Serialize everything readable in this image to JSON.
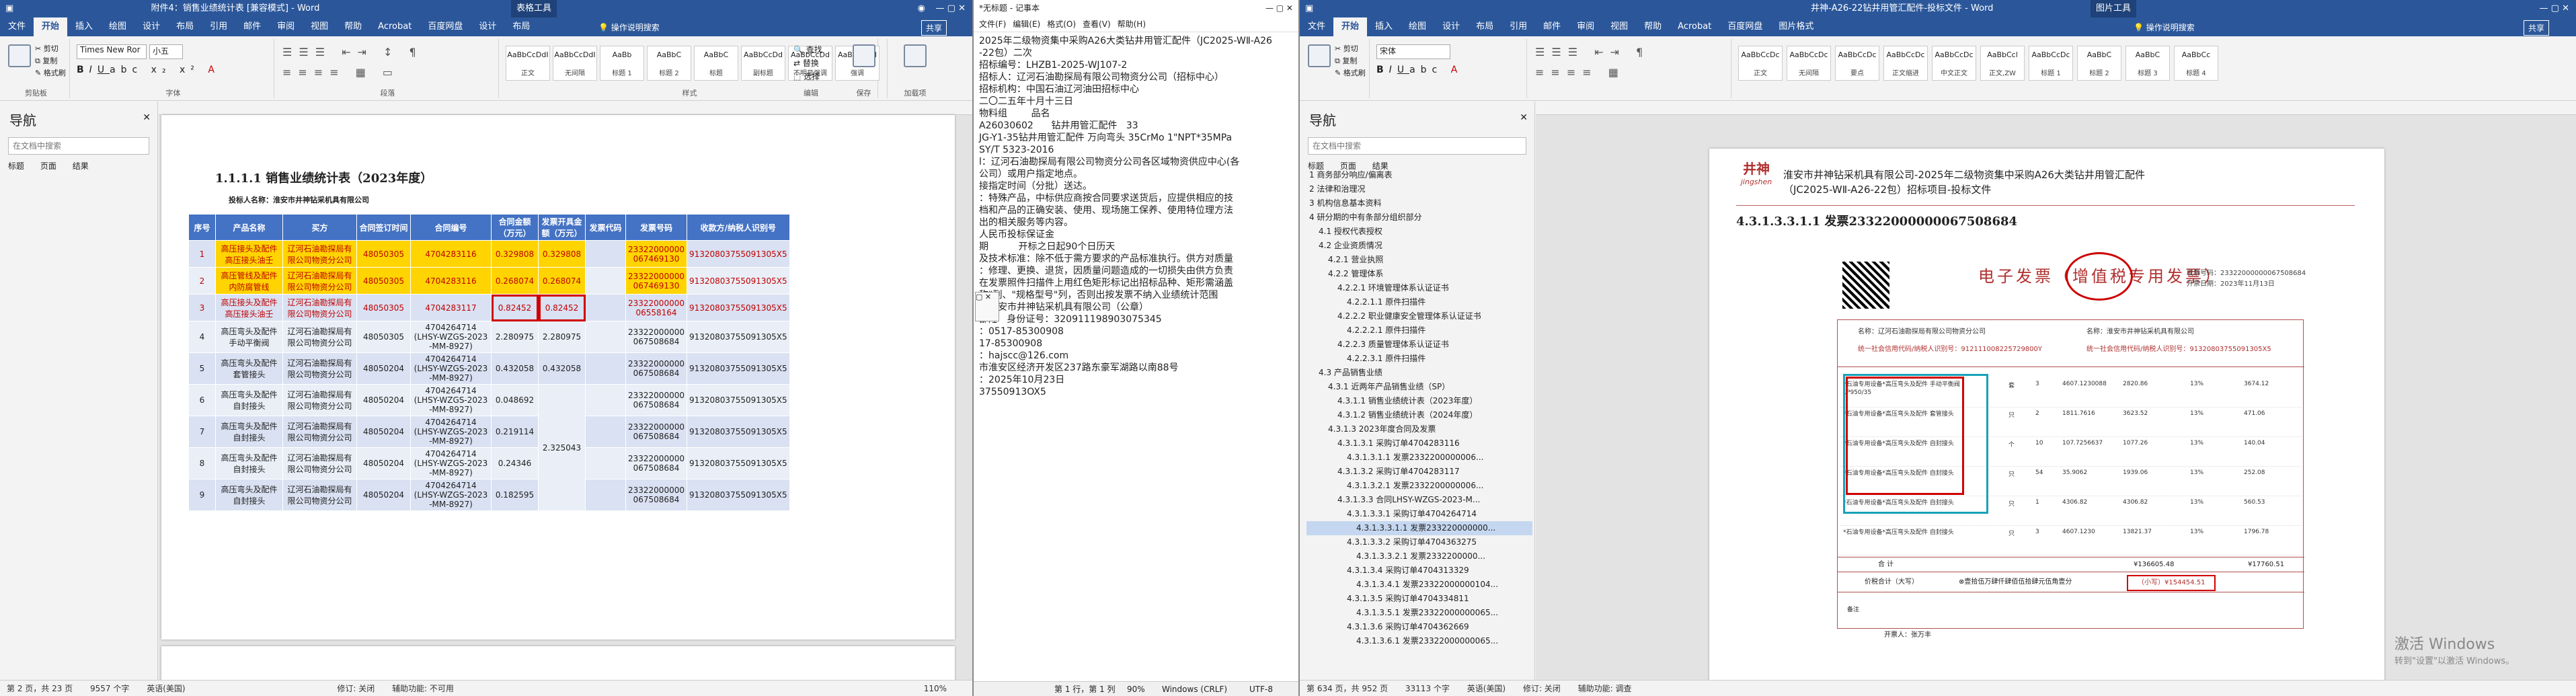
{
  "word1": {
    "title": "附件4：销售业绩统计表 [兼容模式] - Word",
    "context_tab": "表格工具",
    "tabs": [
      "文件",
      "开始",
      "插入",
      "绘图",
      "设计",
      "布局",
      "引用",
      "邮件",
      "审阅",
      "视图",
      "帮助",
      "Acrobat",
      "百度网盘",
      "设计",
      "布局"
    ],
    "search_hint": "操作说明搜索",
    "share": "共享",
    "font_name": "Times New Ror",
    "font_size": "小五",
    "styles": [
      [
        "AaBbCcDdI",
        "正文"
      ],
      [
        "AaBbCcDdI",
        "无间隔"
      ],
      [
        "AaBb",
        "标题 1"
      ],
      [
        "AaBbC",
        "标题 2"
      ],
      [
        "AaBbC",
        "标题"
      ],
      [
        "AaBbCcDd",
        "副标题"
      ],
      [
        "AaBbCcDd",
        "不明显强调"
      ],
      [
        "AaBbCcDd",
        "强调"
      ]
    ],
    "groups": [
      "剪贴板",
      "字体",
      "段落",
      "样式",
      "编辑",
      "保存",
      "加载项"
    ],
    "edit_btns": [
      "查找",
      "替换",
      "选择"
    ],
    "nav_title": "导航",
    "nav_search": "在文档中搜索",
    "nav_tabs": [
      "标题",
      "页面",
      "结果"
    ],
    "heading": "1.1.1.1 销售业绩统计表（2023年度）",
    "vendor": "投标人名称：淮安市井神钻采机具有限公司",
    "columns": [
      "序号",
      "产品名称",
      "买方",
      "合同签订时间",
      "合同编号",
      "合同金额（万元）",
      "发票开具金额（万元）",
      "发票代码",
      "发票号码",
      "收款方/纳税人识别号"
    ],
    "rows": [
      [
        "1",
        "高压接头及配件 高压接头油壬",
        "辽河石油勘探局有限公司物资分公司",
        "48050305",
        "4704283116",
        "0.329808",
        "0.329808",
        "",
        "23322000000 067469130",
        "91320803755091305X5"
      ],
      [
        "2",
        "高压管线及配件 内防腐管线",
        "辽河石油勘探局有限公司物资分公司",
        "48050305",
        "4704283116",
        "0.268074",
        "0.268074",
        "",
        "23322000000 067469130",
        "91320803755091305X5"
      ],
      [
        "3",
        "高压接头及配件 高压接头油壬",
        "辽河石油勘探局有限公司物资分公司",
        "48050305",
        "4704283117",
        "0.82452",
        "0.82452",
        "",
        "23322000000 06558164",
        "91320803755091305X5"
      ],
      [
        "4",
        "高压弯头及配件 手动平衡阀",
        "辽河石油勘探局有限公司物资分公司",
        "48050305",
        "4704264714 (LHSY-WZGS-2023 -MM-8927)",
        "2.280975",
        "2.280975",
        "",
        "23322000000 067508684",
        "91320803755091305X5"
      ],
      [
        "5",
        "高压弯头及配件 套管接头",
        "辽河石油勘探局有限公司物资分公司",
        "48050204",
        "4704264714 (LHSY-WZGS-2023 -MM-8927)",
        "0.432058",
        "0.432058",
        "",
        "23322000000 067508684",
        "91320803755091305X5"
      ],
      [
        "6",
        "高压弯头及配件 自封接头",
        "辽河石油勘探局有限公司物资分公司",
        "48050204",
        "4704264714 (LHSY-WZGS-2023 -MM-8927)",
        "0.048692",
        "",
        "",
        "23322000000 067508684",
        "91320803755091305X5"
      ],
      [
        "7",
        "高压弯头及配件 自封接头",
        "辽河石油勘探局有限公司物资分公司",
        "48050204",
        "4704264714 (LHSY-WZGS-2023 -MM-8927)",
        "0.219114",
        "2.325043",
        "",
        "23322000000 067508684",
        "91320803755091305X5"
      ],
      [
        "8",
        "高压弯头及配件 自封接头",
        "辽河石油勘探局有限公司物资分公司",
        "48050204",
        "4704264714 (LHSY-WZGS-2023 -MM-8927)",
        "0.24346",
        "",
        "",
        "23322000000 067508684",
        "91320803755091305X5"
      ],
      [
        "9",
        "高压弯头及配件 自封接头",
        "辽河石油勘探局有限公司物资分公司",
        "48050204",
        "4704264714 (LHSY-WZGS-2023 -MM-8927)",
        "0.182595",
        "",
        "",
        "23322000000 067508684",
        "91320803755091305X5"
      ]
    ],
    "status": [
      "第 2 页，共 23 页",
      "9557 个字",
      "英语(美国)",
      "修订: 关闭",
      "辅助功能: 不可用"
    ],
    "zoom": "110%"
  },
  "notepad": {
    "title": "*无标题 - 记事本",
    "menu": [
      "文件(F)",
      "编辑(E)",
      "格式(O)",
      "查看(V)",
      "帮助(H)"
    ],
    "lines": [
      "2025年二级物资集中采购A26大类钻井用管汇配件（JC2025-WⅡ-A26",
      "-22包）二次",
      "",
      "招标编号：LHZB1-2025-WJ107-2",
      "",
      "招标人：辽河石油勘探局有限公司物资分公司（招标中心）",
      "招标机构：中国石油辽河油田招标中心",
      "二〇二五年十月十三日",
      "",
      "物料组        品名",
      "A26030602      钻井用管汇配件   33",
      "",
      "JG-Y1-35钻井用管汇配件 万向弯头 35CrMo 1\"NPT*35MPa",
      "",
      "SY/T 5323-2016",
      "",
      "",
      "l：辽河石油勘探局有限公司物资分公司各区域物资供应中心(各",
      "公司）或用户指定地点。",
      "",
      "接指定时间（分批）送达。",
      "",
      "：特殊产品，中标供应商按合同要求送货后，应提供相应的技",
      "档和产品的正确安装、使用、现场施工保养、使用特位理方法",
      "出的相关服务等内容。",
      "",
      "人民币投标保证金",
      "",
      "期          开标之日起90个日历天",
      "",
      "及技术标准：除不低于需方要求的产品标准执行。供方对质量",
      "：修理、更换、退货，因质量问题造成的一切损失由供方负责",
      "",
      "",
      "在发票照件扫描件上用红色矩形标记出招标品种、矩形需涵盖",
      "称\"列、\"规格型号\"列，否则出按发票不纳入业绩统计范围",
      "",
      "",
      "",
      "",
      "：淮安市井神钻采机具有限公司（公章）",
      "部陲   身份证号：320911198903075345",
      "：0517-85300908",
      "17-85300908",
      "：hajscc@126.com",
      "市淮安区经济开发区237路东豪军湖路以南88号",
      "：2025年10月23日",
      "",
      "",
      "37550913OX5"
    ],
    "status": [
      "第 1 行，第 1 列",
      "90%",
      "Windows (CRLF)",
      "UTF-8"
    ]
  },
  "word2": {
    "title": "井神-A26-22钻井用管汇配件-投标文件 - Word",
    "context_tab": "图片工具",
    "tabs": [
      "文件",
      "开始",
      "插入",
      "绘图",
      "设计",
      "布局",
      "引用",
      "邮件",
      "审阅",
      "视图",
      "帮助",
      "Acrobat",
      "百度网盘",
      "图片格式"
    ],
    "search_hint": "操作说明搜索",
    "share": "共享",
    "styles": [
      [
        "AaBbCcDc",
        "正文"
      ],
      [
        "AaBbCcDc",
        "无间隔"
      ],
      [
        "AaBbCcDc",
        "要点"
      ],
      [
        "AaBbCcDc",
        "正文缩进"
      ],
      [
        "AaBbCcDc",
        "中文正文"
      ],
      [
        "AaBbCcl",
        "正文,ZW"
      ],
      [
        "AaBbCcDc",
        "标题 1"
      ],
      [
        "AaBbC",
        "标题 2"
      ],
      [
        "AaBbC",
        "标题 3"
      ],
      [
        "AaBbCc",
        "标题 4"
      ]
    ],
    "nav_title": "导航",
    "nav_search": "在文档中搜索",
    "nav_tabs": [
      "标题",
      "页面",
      "结果"
    ],
    "nav_items": [
      [
        "0",
        "1 商务部分响应/偏离表"
      ],
      [
        "0",
        "2 法律和治理况"
      ],
      [
        "0",
        "3 机构信息基本资料"
      ],
      [
        "0",
        "4 研分期的中有条部分组织部分"
      ],
      [
        "1",
        "4.1 授权代表授权"
      ],
      [
        "1",
        "4.2 企业资质情况"
      ],
      [
        "2",
        "4.2.1 营业执照"
      ],
      [
        "2",
        "4.2.2 管理体系"
      ],
      [
        "3",
        "4.2.2.1 环境管理体系认证证书"
      ],
      [
        "4",
        "4.2.2.1.1 原件扫描件"
      ],
      [
        "3",
        "4.2.2.2 职业健康安全管理体系认证证书"
      ],
      [
        "4",
        "4.2.2.2.1 原件扫描件"
      ],
      [
        "3",
        "4.2.2.3 质量管理体系认证证书"
      ],
      [
        "4",
        "4.2.2.3.1 原件扫描件"
      ],
      [
        "1",
        "4.3 产品销售业绩"
      ],
      [
        "2",
        "4.3.1 近两年产品销售业绩（SP）"
      ],
      [
        "3",
        "4.3.1.1 销售业绩统计表（2023年度）"
      ],
      [
        "3",
        "4.3.1.2 销售业绩统计表（2024年度）"
      ],
      [
        "2",
        "4.3.1.3 2023年度合同及发票"
      ],
      [
        "3",
        "4.3.1.3.1 采购订单4704283116"
      ],
      [
        "4",
        "4.3.1.3.1.1 发票2332200000006..."
      ],
      [
        "3",
        "4.3.1.3.2 采购订单4704283117"
      ],
      [
        "4",
        "4.3.1.3.2.1 发票2332200000006..."
      ],
      [
        "3",
        "4.3.1.3.3 合同LHSY-WZGS-2023-M..."
      ],
      [
        "4",
        "4.3.1.3.3.1 采购订单4704264714"
      ],
      [
        "5",
        "4.3.1.3.3.1.1 发票233220000000..."
      ],
      [
        "4",
        "4.3.1.3.3.2 采购订单4704363275"
      ],
      [
        "5",
        "4.3.1.3.3.2.1 发票2332200000..."
      ],
      [
        "4",
        "4.3.1.3.4 采购订单4704313329"
      ],
      [
        "5",
        "4.3.1.3.4.1 发票23322000000104..."
      ],
      [
        "4",
        "4.3.1.3.5 采购订单4704334811"
      ],
      [
        "5",
        "4.3.1.3.5.1 发票23322000000065..."
      ],
      [
        "4",
        "4.3.1.3.6 采购订单4704362669"
      ],
      [
        "5",
        "4.3.1.3.6.1 发票23322000000065..."
      ]
    ],
    "selected_nav": 25,
    "header_company": "淮安市井神钻采机具有限公司-2025年二级物资集中采购A26大类钻井用管汇配件（JC2025-WⅡ-A26-22包）招标项目-投标文件",
    "logo_cn": "井神",
    "logo_en": "jingshen",
    "heading": "4.3.1.3.3.1.1 发票23322000000067508684",
    "invoice": {
      "title": "电子发票（增值税专用发票）",
      "no_label": "发票号码：",
      "no": "23322000000067508684",
      "date_label": "开票日期：",
      "date": "2023年11月13日",
      "buyer": "名称：辽河石油勘探局有限公司物资分公司",
      "buyer_tax": "统一社会信用代码/纳税人识别号：912111008225729800Y",
      "seller": "名称：淮安市井神钻采机具有限公司",
      "seller_tax": "统一社会信用代码/纳税人识别号：91320803755091305X5",
      "items": [
        [
          "*石油专用设备*高压弯头及配件 手动平衡阀 LP950/35",
          "套",
          "3",
          "4607.1230088",
          "2820.86",
          "13%",
          "3674.12"
        ],
        [
          "*石油专用设备*高压弯头及配件 套管接头",
          "只",
          "2",
          "1811.7616",
          "3623.52",
          "13%",
          "471.06"
        ],
        [
          "*石油专用设备*高压弯头及配件 自封接头",
          "个",
          "10",
          "107.7256637",
          "1077.26",
          "13%",
          "140.04"
        ],
        [
          "*石油专用设备*高压弯头及配件 自封接头",
          "只",
          "54",
          "35.9062",
          "1939.06",
          "13%",
          "252.08"
        ],
        [
          "*石油专用设备*高压弯头及配件 自封接头",
          "只",
          "1",
          "4306.82",
          "4306.82",
          "13%",
          "560.53"
        ],
        [
          "*石油专用设备*高压弯头及配件 自封接头",
          "只",
          "3",
          "4607.1230",
          "13821.37",
          "13%",
          "1796.78"
        ]
      ],
      "total_label": "合 计",
      "total_amount": "¥136605.48",
      "total_tax": "¥17760.51",
      "grand_label": "价税合计（大写）",
      "grand_words": "⊗壹拾伍万肆仟肆佰伍拾肆元伍角壹分",
      "grand_small": "（小写）¥154454.51",
      "remark": "备注",
      "drawer": "开票人：张万丰"
    },
    "status": [
      "第 634 页，共 952 页",
      "33113 个字",
      "英语(美国)",
      "修订: 关闭",
      "辅助功能: 调查"
    ],
    "watermark1": "激活 Windows",
    "watermark2": "转到\"设置\"以激活 Windows。"
  },
  "colors": {
    "word_blue": "#2b579a",
    "table_header": "#4472c4",
    "highlight": "#ffd400",
    "mark_red": "#d00000",
    "mark_cyan": "#17a2b8"
  }
}
